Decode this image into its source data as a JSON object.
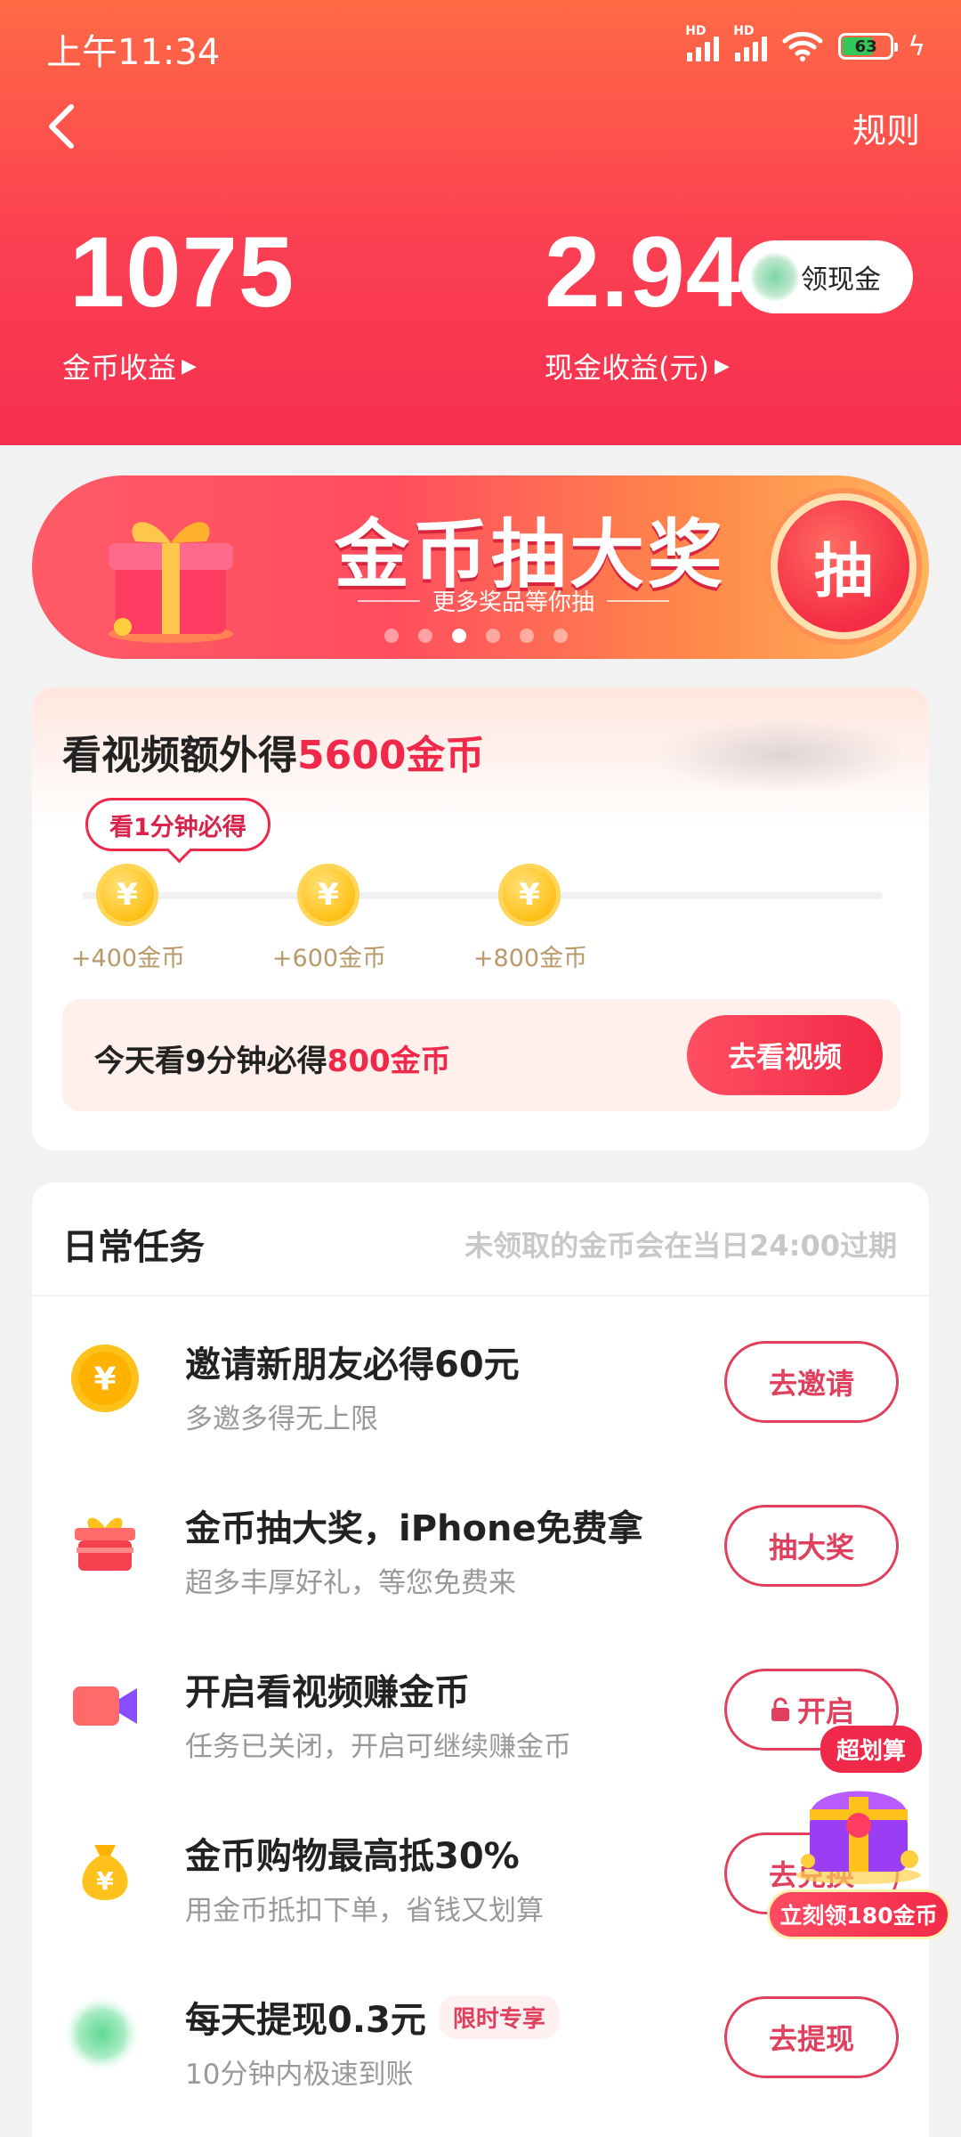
{
  "status_bar": {
    "time": "上午11:34",
    "signal_label": "HD",
    "battery": "63"
  },
  "nav": {
    "back_icon": "chevron-left-icon",
    "rules": "规则"
  },
  "earnings": {
    "gold_value": "1075",
    "gold_label": "金币收益",
    "cash_value": "2.94",
    "cash_label": "现金收益(元)",
    "withdraw_button": "领现金"
  },
  "banner": {
    "title": "金币抽大奖",
    "subtitle": "更多奖品等你抽",
    "draw_button": "抽",
    "dots_count": 6,
    "active_dot": 2
  },
  "video_task": {
    "title_prefix": "看视频额外得",
    "title_highlight": "5600金币",
    "tip": "看1分钟必得",
    "milestones": [
      {
        "label": "+400金币",
        "coin": "¥"
      },
      {
        "label": "+600金币",
        "coin": "¥"
      },
      {
        "label": "+800金币",
        "coin": "¥"
      }
    ],
    "today_prefix": "今天看9分钟必得",
    "today_highlight": "800金币",
    "watch_button": "去看视频"
  },
  "daily_tasks": {
    "title": "日常任务",
    "note": "未领取的金币会在当日24:00过期",
    "items": [
      {
        "icon": "coin-icon",
        "name": "邀请新朋友必得60元",
        "desc": "多邀多得无上限",
        "button": "去邀请"
      },
      {
        "icon": "gift-icon",
        "name": "金币抽大奖，iPhone免费拿",
        "desc": "超多丰厚好礼，等您免费来",
        "button": "抽大奖"
      },
      {
        "icon": "video-camera-icon",
        "name": "开启看视频赚金币",
        "desc": "任务已关闭，开启可继续赚金币",
        "button": "开启",
        "button_icon": "lock-icon"
      },
      {
        "icon": "money-bag-icon",
        "name": "金币购物最高抵30%",
        "desc": "用金币抵扣下单，省钱又划算",
        "button": "去兑换"
      },
      {
        "icon": "cash-icon",
        "name": "每天提现0.3元",
        "tag": "限时专享",
        "desc": "10分钟内极速到账",
        "button": "去提现"
      }
    ]
  },
  "floating_reward": {
    "badge": "超划算",
    "cta": "立刻领180金币"
  },
  "colors": {
    "header_start": "#ff6a45",
    "header_end": "#f6304f",
    "accent_red": "#f0284a",
    "coin_gold": "#ffc21c"
  }
}
